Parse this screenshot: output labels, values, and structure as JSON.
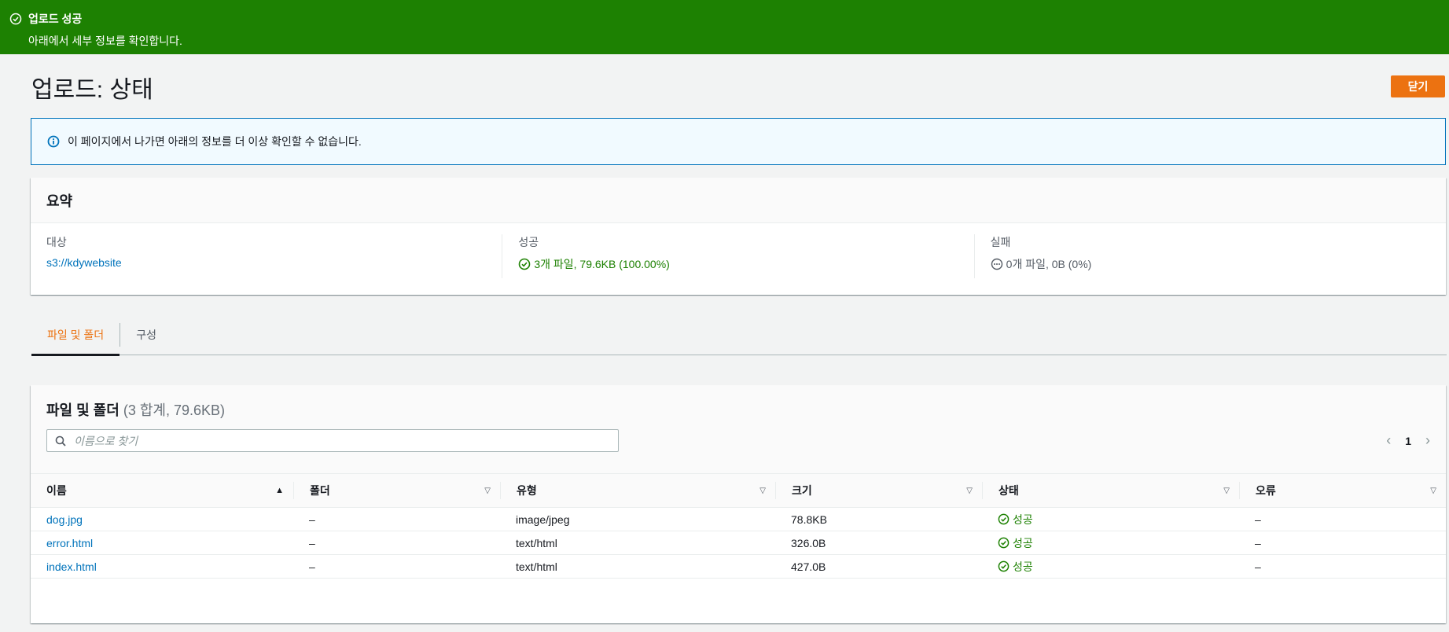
{
  "flash": {
    "title": "업로드 성공",
    "message": "아래에서 세부 정보를 확인합니다."
  },
  "page": {
    "title": "업로드: 상태",
    "close_label": "닫기"
  },
  "alert": {
    "message": "이 페이지에서 나가면 아래의 정보를 더 이상 확인할 수 없습니다."
  },
  "summary": {
    "title": "요약",
    "target_label": "대상",
    "target_value": "s3://kdywebsite",
    "success_label": "성공",
    "success_value": "3개 파일, 79.6KB (100.00%)",
    "failed_label": "실패",
    "failed_value": "0개 파일, 0B (0%)"
  },
  "tabs": [
    {
      "label": "파일 및 폴더",
      "active": true
    },
    {
      "label": "구성",
      "active": false
    }
  ],
  "files": {
    "title": "파일 및 폴더",
    "count": "(3 합계, 79.6KB)",
    "search_placeholder": "이름으로 찾기",
    "page": "1",
    "columns": [
      "이름",
      "폴더",
      "유형",
      "크기",
      "상태",
      "오류"
    ],
    "rows": [
      {
        "name": "dog.jpg",
        "folder": "–",
        "type": "image/jpeg",
        "size": "78.8KB",
        "status": "성공",
        "error": "–"
      },
      {
        "name": "error.html",
        "folder": "–",
        "type": "text/html",
        "size": "326.0B",
        "status": "성공",
        "error": "–"
      },
      {
        "name": "index.html",
        "folder": "–",
        "type": "text/html",
        "size": "427.0B",
        "status": "성공",
        "error": "–"
      }
    ]
  },
  "colors": {
    "flash_success": "#1d8102",
    "primary_button": "#ec7211",
    "link": "#0073bb",
    "info_border": "#0073bb"
  }
}
